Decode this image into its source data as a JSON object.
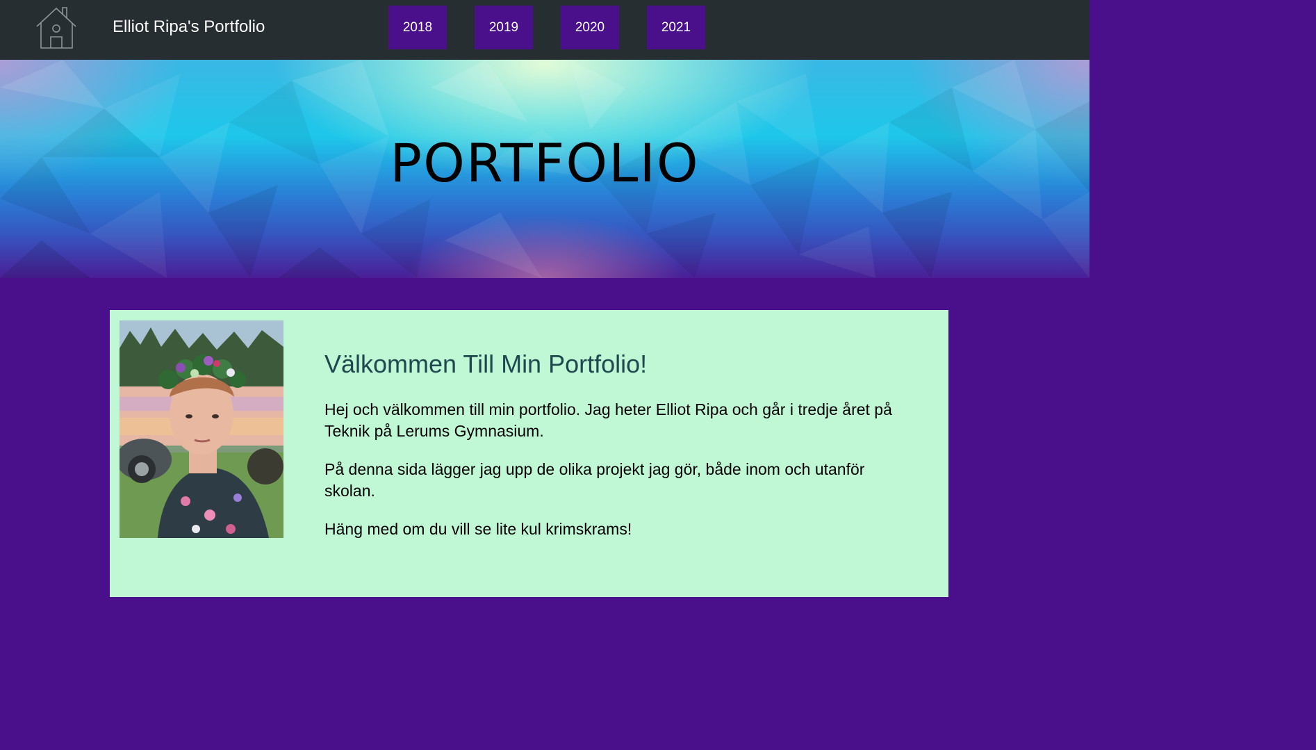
{
  "header": {
    "site_title": "Elliot Ripa's Portfolio",
    "home_icon": "house-outline-icon",
    "nav": [
      {
        "label": "2018"
      },
      {
        "label": "2019"
      },
      {
        "label": "2020"
      },
      {
        "label": "2021"
      }
    ]
  },
  "hero": {
    "title": "PORTFOLIO"
  },
  "intro": {
    "heading": "Välkommen Till Min Portfolio!",
    "paragraphs": [
      "Hej och välkommen till min portfolio. Jag heter Elliot Ripa och går i tredje året på Teknik på Lerums Gymnasium.",
      "På denna sida lägger jag upp de olika projekt jag gör, både inom och utanför skolan.",
      "Häng med om du vill se lite kul krimskrams!"
    ]
  },
  "colors": {
    "topbar": "#272e31",
    "accent_purple": "#4a108c",
    "card_mint": "#c0f8d6",
    "heading_teal": "#1f474f"
  }
}
